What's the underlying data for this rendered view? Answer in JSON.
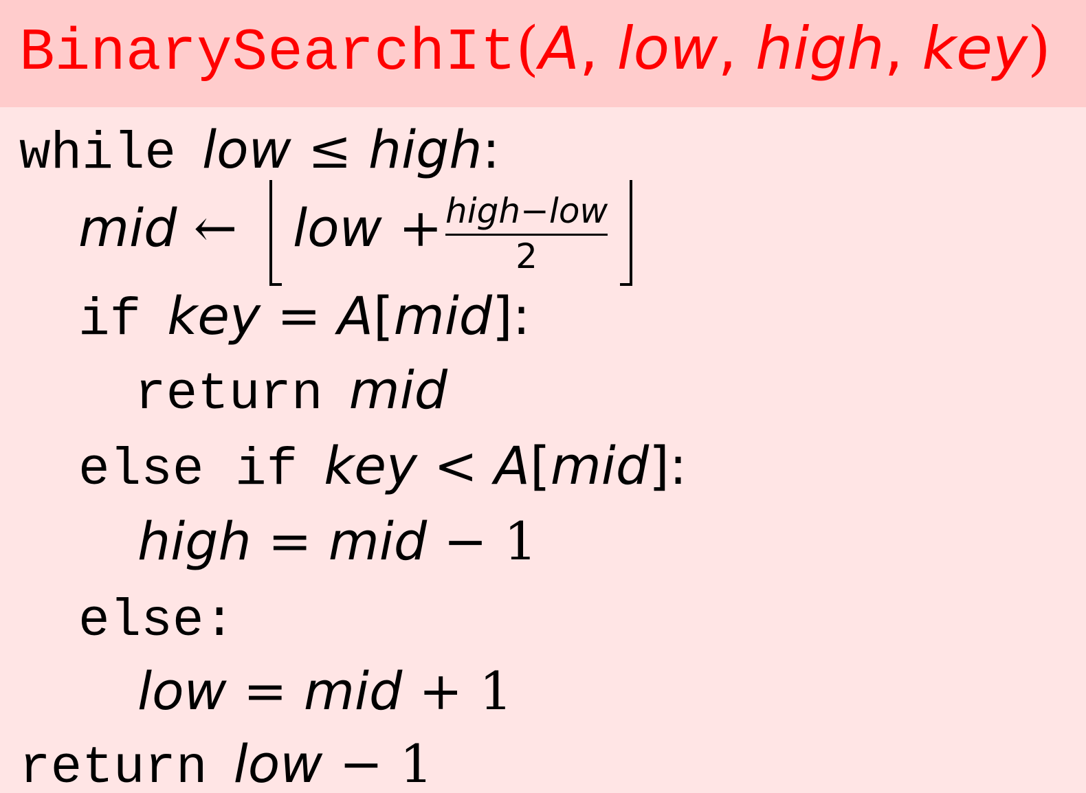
{
  "header": {
    "func_name": "BinarySearchIt",
    "open_paren": "(",
    "params": [
      "A",
      "low",
      "high",
      "key"
    ],
    "comma": ",",
    "close_paren": ")"
  },
  "code": {
    "kw_while": "while",
    "kw_if": "if",
    "kw_return": "return",
    "kw_else_if": "else if",
    "kw_else": "else:",
    "var_low": "low",
    "var_high": "high",
    "var_mid": "mid",
    "var_key": "key",
    "var_A": "A",
    "num_1": "1",
    "num_2": "2",
    "op_le": "≤",
    "op_lt": "<",
    "op_eq": "=",
    "op_plus": "+",
    "op_minus": "−",
    "op_arrow": "←",
    "colon": ":",
    "lbracket": "[",
    "rbracket": "]"
  }
}
